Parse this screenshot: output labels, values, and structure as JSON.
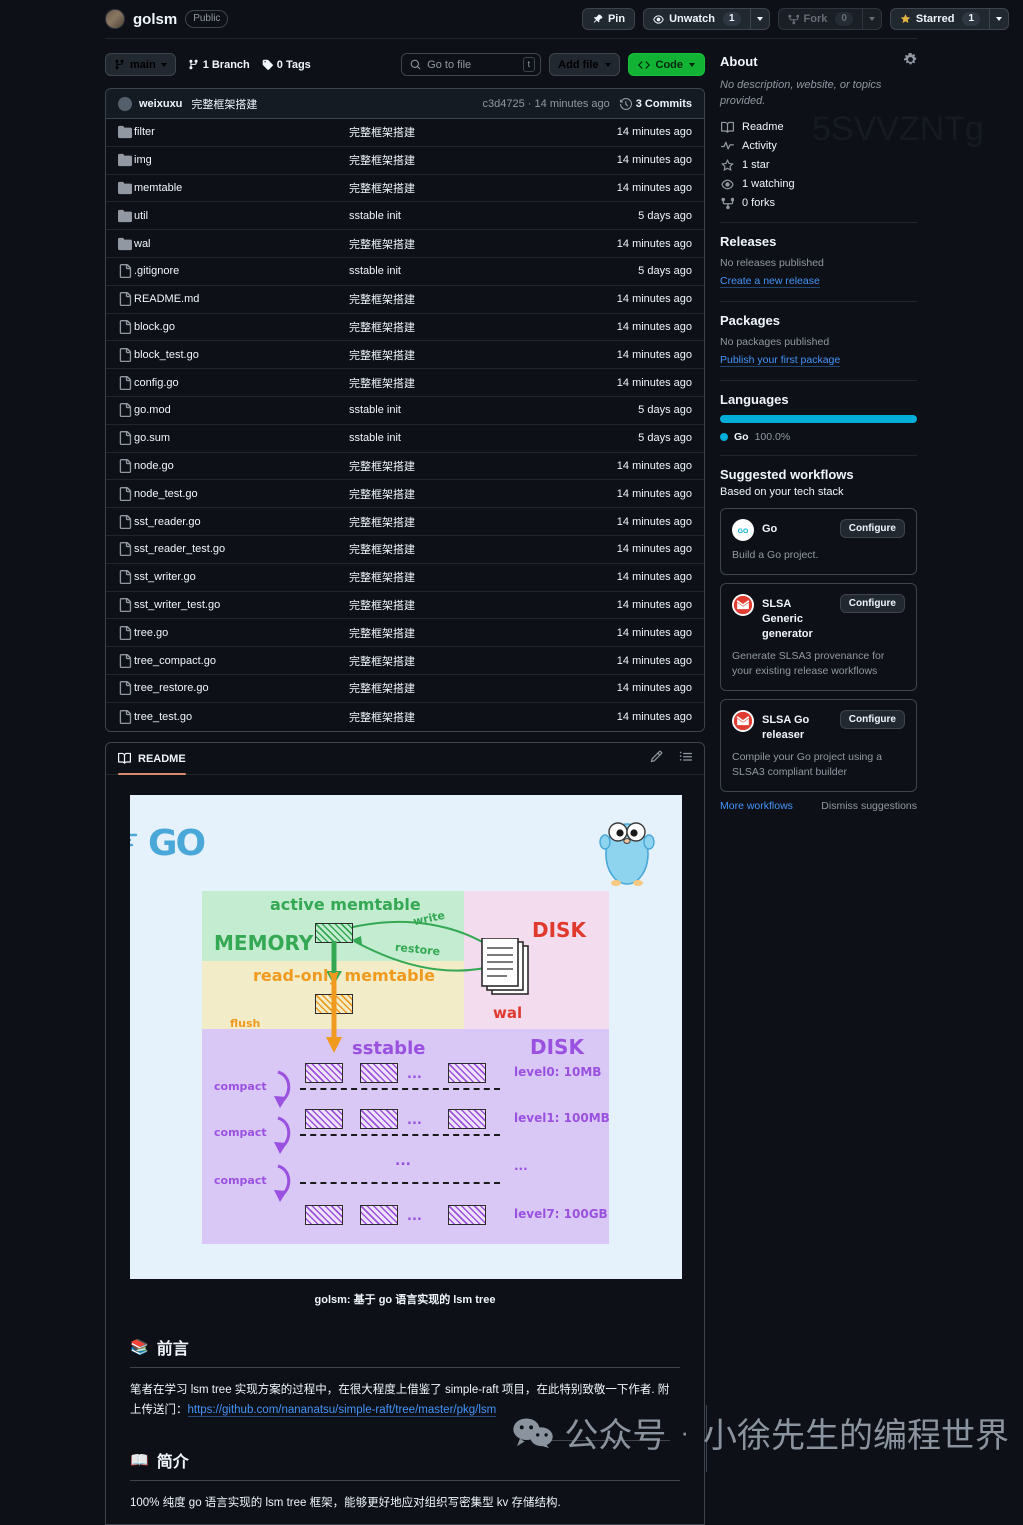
{
  "header": {
    "repo_name": "golsm",
    "visibility": "Public",
    "pin_label": "Pin",
    "unwatch_label": "Unwatch",
    "unwatch_count": "1",
    "fork_label": "Fork",
    "fork_count": "0",
    "star_label": "Starred",
    "star_count": "1"
  },
  "toolbar": {
    "branch": "main",
    "branch_count": "1 Branch",
    "tag_count": "0 Tags",
    "search_placeholder": "Go to file",
    "search_key": "t",
    "add_file_label": "Add file",
    "code_label": "Code"
  },
  "commit_bar": {
    "author": "weixuxu",
    "message": "完整框架搭建",
    "sha": "c3d4725",
    "time": "14 minutes ago",
    "commits": "3 Commits"
  },
  "files": [
    {
      "type": "folder",
      "name": "filter",
      "message": "完整框架搭建",
      "time": "14 minutes ago"
    },
    {
      "type": "folder",
      "name": "img",
      "message": "完整框架搭建",
      "time": "14 minutes ago"
    },
    {
      "type": "folder",
      "name": "memtable",
      "message": "完整框架搭建",
      "time": "14 minutes ago"
    },
    {
      "type": "folder",
      "name": "util",
      "message": "sstable init",
      "time": "5 days ago"
    },
    {
      "type": "folder",
      "name": "wal",
      "message": "完整框架搭建",
      "time": "14 minutes ago"
    },
    {
      "type": "file",
      "name": ".gitignore",
      "message": "sstable init",
      "time": "5 days ago"
    },
    {
      "type": "file",
      "name": "README.md",
      "message": "完整框架搭建",
      "time": "14 minutes ago"
    },
    {
      "type": "file",
      "name": "block.go",
      "message": "完整框架搭建",
      "time": "14 minutes ago"
    },
    {
      "type": "file",
      "name": "block_test.go",
      "message": "完整框架搭建",
      "time": "14 minutes ago"
    },
    {
      "type": "file",
      "name": "config.go",
      "message": "完整框架搭建",
      "time": "14 minutes ago"
    },
    {
      "type": "file",
      "name": "go.mod",
      "message": "sstable init",
      "time": "5 days ago"
    },
    {
      "type": "file",
      "name": "go.sum",
      "message": "sstable init",
      "time": "5 days ago"
    },
    {
      "type": "file",
      "name": "node.go",
      "message": "完整框架搭建",
      "time": "14 minutes ago"
    },
    {
      "type": "file",
      "name": "node_test.go",
      "message": "完整框架搭建",
      "time": "14 minutes ago"
    },
    {
      "type": "file",
      "name": "sst_reader.go",
      "message": "完整框架搭建",
      "time": "14 minutes ago"
    },
    {
      "type": "file",
      "name": "sst_reader_test.go",
      "message": "完整框架搭建",
      "time": "14 minutes ago"
    },
    {
      "type": "file",
      "name": "sst_writer.go",
      "message": "完整框架搭建",
      "time": "14 minutes ago"
    },
    {
      "type": "file",
      "name": "sst_writer_test.go",
      "message": "完整框架搭建",
      "time": "14 minutes ago"
    },
    {
      "type": "file",
      "name": "tree.go",
      "message": "完整框架搭建",
      "time": "14 minutes ago"
    },
    {
      "type": "file",
      "name": "tree_compact.go",
      "message": "完整框架搭建",
      "time": "14 minutes ago"
    },
    {
      "type": "file",
      "name": "tree_restore.go",
      "message": "完整框架搭建",
      "time": "14 minutes ago"
    },
    {
      "type": "file",
      "name": "tree_test.go",
      "message": "完整框架搭建",
      "time": "14 minutes ago"
    }
  ],
  "about": {
    "title": "About",
    "description": "No description, website, or topics provided.",
    "items": [
      {
        "icon": "book-icon",
        "label": "Readme"
      },
      {
        "icon": "pulse-icon",
        "label": "Activity"
      },
      {
        "icon": "star-icon",
        "label": "1 star"
      },
      {
        "icon": "eye-icon",
        "label": "1 watching"
      },
      {
        "icon": "fork-icon",
        "label": "0 forks"
      }
    ]
  },
  "releases": {
    "title": "Releases",
    "empty": "No releases published",
    "link": "Create a new release"
  },
  "packages": {
    "title": "Packages",
    "empty": "No packages published",
    "link": "Publish your first package"
  },
  "languages": {
    "title": "Languages",
    "name": "Go",
    "percent": "100.0%",
    "color": "#00ADD8"
  },
  "workflows": {
    "title": "Suggested workflows",
    "subtitle": "Based on your tech stack",
    "configure_label": "Configure",
    "cards": [
      {
        "icon": "go-icon",
        "name": "Go",
        "desc": "Build a Go project."
      },
      {
        "icon": "slsa-icon",
        "name": "SLSA Generic generator",
        "desc": "Generate SLSA3 provenance for your existing release workflows"
      },
      {
        "icon": "slsa-icon",
        "name": "SLSA Go releaser",
        "desc": "Compile your Go project using a SLSA3 compliant builder"
      }
    ],
    "more_label": "More workflows",
    "dismiss_label": "Dismiss suggestions"
  },
  "readme": {
    "tab_label": "README",
    "caption": "golsm: 基于 go 语言实现的 lsm tree",
    "section1_title": "前言",
    "section1_emoji": "📚",
    "section1_text": "笔者在学习 lsm tree 实现方案的过程中，在很大程度上借鉴了 simple-raft 项目，在此特别致敬一下作者. 附上传送门：",
    "section1_link": "https://github.com/nananatsu/simple-raft/tree/master/pkg/lsm",
    "section2_title": "简介",
    "section2_emoji": "📖",
    "section2_text": "100% 纯度 go 语言实现的 lsm tree 框架，能够更好地应对组织写密集型 kv 存储结构."
  },
  "diagram": {
    "go_logo": "GO",
    "memory_label": "MEMORY",
    "active_memtable": "active memtable",
    "readonly_memtable": "read-only memtable",
    "write_label": "write",
    "restore_label": "restore",
    "flush_label": "flush",
    "disk_label_top": "DISK",
    "wal_label": "wal",
    "sstable_label": "sstable",
    "disk_label_bottom": "DISK",
    "compact_label": "compact",
    "ellipsis": "...",
    "levels": [
      {
        "label": "level0: 10MB"
      },
      {
        "label": "level1: 100MB"
      },
      {
        "label": "..."
      },
      {
        "label": "level7: 100GB"
      }
    ]
  },
  "watermarks": {
    "code": "5SVVZNTg",
    "wechat_prefix": "公众号",
    "wechat_sep": "·",
    "wechat_name": "小徐先生的编程世界"
  }
}
